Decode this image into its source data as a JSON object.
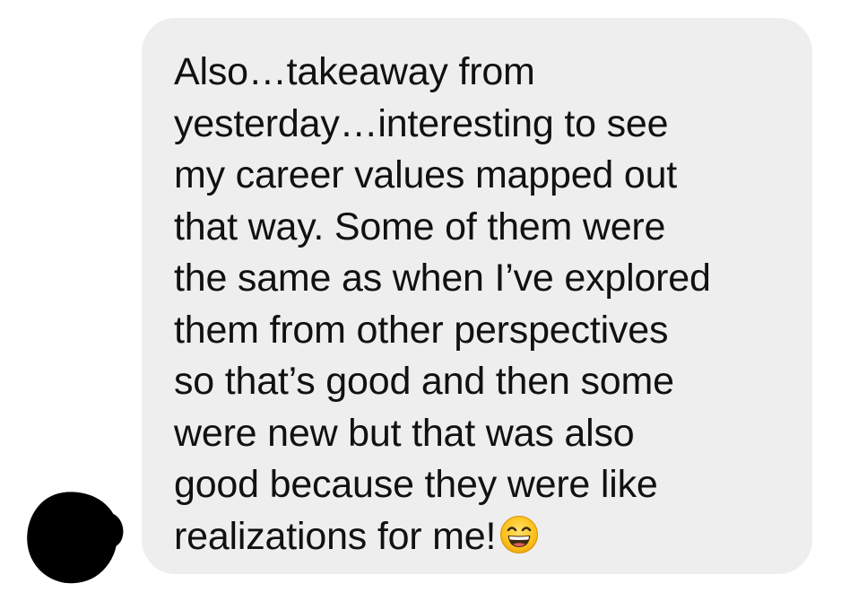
{
  "message": {
    "text": "Also…takeaway from\nyesterday…interesting to see\nmy career values mapped out\nthat way. Some of them were\nthe same as when I’ve explored\nthem from other perspectives\nso that’s good and then some\nwere new but that was also\ngood because they were like\nrealizations for me!",
    "emoji": "grinning-squinting-face",
    "bubble_color": "#eeeeef",
    "text_color": "#111111"
  },
  "sender": {
    "avatar_color": "#000000"
  }
}
